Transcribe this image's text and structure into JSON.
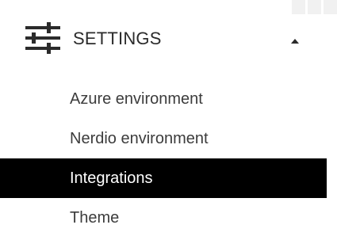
{
  "settings": {
    "title": "SETTINGS",
    "icon": "sliders-icon",
    "collapse_icon": "caret-up-icon",
    "items": [
      {
        "label": "Azure environment",
        "active": false
      },
      {
        "label": "Nerdio environment",
        "active": false
      },
      {
        "label": "Integrations",
        "active": true
      },
      {
        "label": "Theme",
        "active": false
      }
    ]
  },
  "colors": {
    "active_background": "#000000",
    "active_text": "#ffffff",
    "text": "#3c3c3c",
    "icon": "#2b2b2b"
  }
}
